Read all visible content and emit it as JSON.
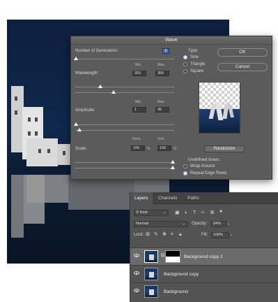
{
  "wave_dialog": {
    "title": "Wave",
    "generators_label": "Number of Generators:",
    "generators_value": "5",
    "wavelength": {
      "label": "Wavelength:",
      "min_label": "Min.",
      "max_label": "Max.",
      "min": "263",
      "max": "355"
    },
    "amplitude": {
      "label": "Amplitude:",
      "min_label": "Min.",
      "max_label": "Max.",
      "min": "1",
      "max": "45"
    },
    "scale": {
      "label": "Scale:",
      "horiz_label": "Horiz.",
      "vert_label": "Vert.",
      "horiz": "100",
      "vert": "100",
      "unit": "%"
    },
    "type_label": "Type:",
    "type_options": [
      "Sine",
      "Triangle",
      "Square"
    ],
    "type_selected": "Sine",
    "ok_label": "OK",
    "cancel_label": "Cancel",
    "randomize_label": "Randomize",
    "undefined_label": "Undefined Areas:",
    "undefined_options": [
      "Wrap Around",
      "Repeat Edge Pixels"
    ],
    "undefined_selected": "Repeat Edge Pixels"
  },
  "layers_panel": {
    "tabs": [
      "Layers",
      "Channels",
      "Paths"
    ],
    "active_tab": "Layers",
    "filter_kind": "Kind",
    "blend_mode": "Normal",
    "opacity_label": "Opacity:",
    "opacity": "54%",
    "lock_label": "Lock:",
    "fill_label": "Fill:",
    "fill": "100%",
    "layers": [
      {
        "name": "Background copy 2",
        "selected": true,
        "has_mask": true
      },
      {
        "name": "Background copy",
        "selected": false,
        "has_mask": false
      },
      {
        "name": "Background",
        "selected": false,
        "has_mask": false
      }
    ]
  },
  "colors": {
    "accent": "#2f6fc9",
    "dialog_bg": "#5b5b5b",
    "panel_bg": "#535353"
  }
}
